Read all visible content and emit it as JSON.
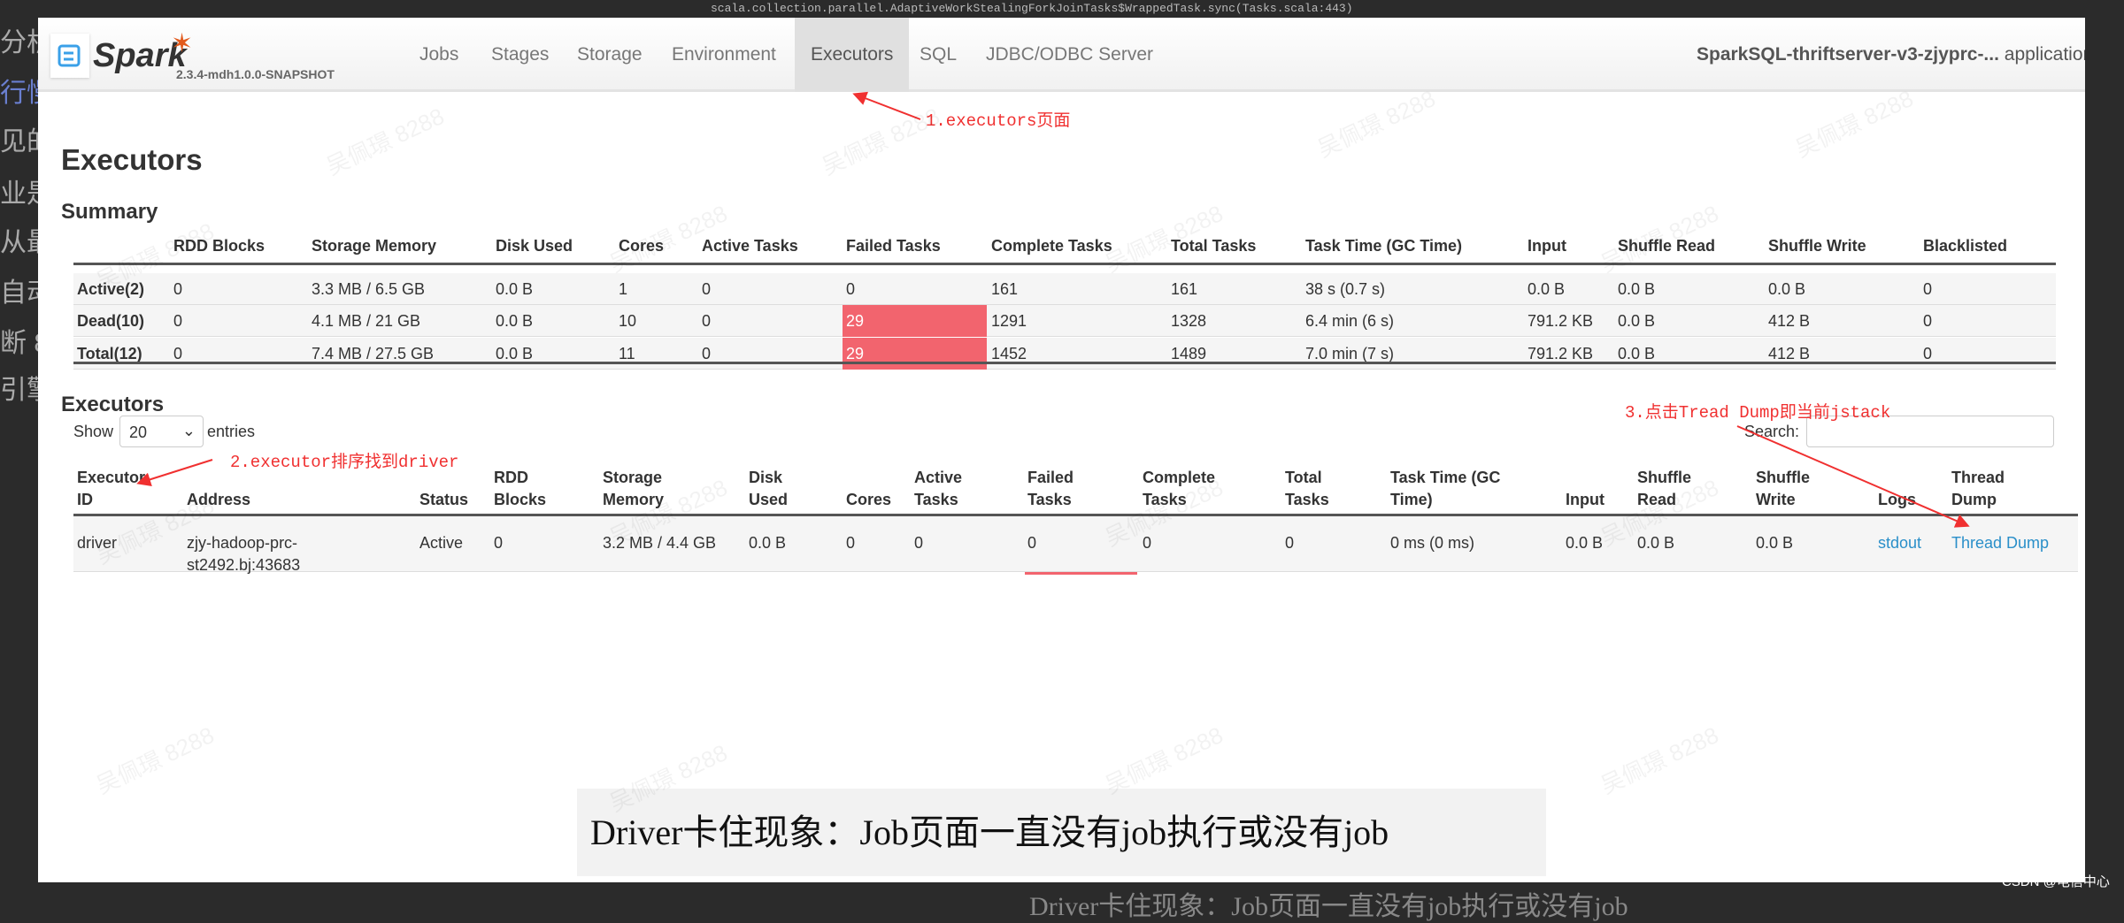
{
  "background": {
    "side_text": [
      "分析思路与技巧",
      "行慢",
      "见的",
      "业是",
      "从最",
      "自动",
      "断 8",
      "引擎"
    ],
    "top_code": "scala.collection.parallel.AdaptiveWorkStealingForkJoinTasks$WrappedTask.sync(Tasks.scala:443)",
    "bottom_text": "Driver卡住现象：Job页面一直没有job执行或没有job",
    "credit": "CSDN @电信中心"
  },
  "nav": {
    "logo_text": "Spark",
    "version": "2.3.4-mdh1.0.0-SNAPSHOT",
    "tabs": [
      "Jobs",
      "Stages",
      "Storage",
      "Environment",
      "Executors",
      "SQL",
      "JDBC/ODBC Server"
    ],
    "active_tab": "Executors",
    "app_name": "SparkSQL-thriftserver-v3-zjyprc-...",
    "app_suffix": "application"
  },
  "page_title": "Executors",
  "summary": {
    "title": "Summary",
    "headers": [
      "",
      "RDD Blocks",
      "Storage Memory",
      "Disk Used",
      "Cores",
      "Active Tasks",
      "Failed Tasks",
      "Complete Tasks",
      "Total Tasks",
      "Task Time (GC Time)",
      "Input",
      "Shuffle Read",
      "Shuffle Write",
      "Blacklisted"
    ],
    "rows": [
      [
        "Active(2)",
        "0",
        "3.3 MB / 6.5 GB",
        "0.0 B",
        "1",
        "0",
        "0",
        "161",
        "161",
        "38 s (0.7 s)",
        "0.0 B",
        "0.0 B",
        "0.0 B",
        "0"
      ],
      [
        "Dead(10)",
        "0",
        "4.1 MB / 21 GB",
        "0.0 B",
        "10",
        "0",
        "29",
        "1291",
        "1328",
        "6.4 min (6 s)",
        "791.2 KB",
        "0.0 B",
        "412 B",
        "0"
      ],
      [
        "Total(12)",
        "0",
        "7.4 MB / 27.5 GB",
        "0.0 B",
        "11",
        "0",
        "29",
        "1452",
        "1489",
        "7.0 min (7 s)",
        "791.2 KB",
        "0.0 B",
        "412 B",
        "0"
      ]
    ],
    "failed_highlight_color": "#f2646e"
  },
  "executors": {
    "title": "Executors",
    "show_label": "Show",
    "entries_value": "20",
    "entries_label": "entries",
    "search_label": "Search:",
    "search_value": "",
    "headers": [
      [
        "Executor",
        "ID"
      ],
      [
        "",
        "Address"
      ],
      [
        "",
        "Status"
      ],
      [
        "RDD",
        "Blocks"
      ],
      [
        "Storage",
        "Memory"
      ],
      [
        "Disk",
        "Used"
      ],
      [
        "",
        "Cores"
      ],
      [
        "Active",
        "Tasks"
      ],
      [
        "Failed",
        "Tasks"
      ],
      [
        "Complete",
        "Tasks"
      ],
      [
        "Total",
        "Tasks"
      ],
      [
        "Task Time (GC",
        "Time)"
      ],
      [
        "",
        "Input"
      ],
      [
        "Shuffle",
        "Read"
      ],
      [
        "Shuffle",
        "Write"
      ],
      [
        "",
        "Logs"
      ],
      [
        "Thread",
        "Dump"
      ]
    ],
    "row": [
      [
        "driver"
      ],
      [
        "zjy-hadoop-prc-",
        "st2492.bj:43683"
      ],
      [
        "Active"
      ],
      [
        "0"
      ],
      [
        "3.2 MB / 4.4 GB"
      ],
      [
        "0.0 B"
      ],
      [
        "0"
      ],
      [
        "0"
      ],
      [
        "0"
      ],
      [
        "0"
      ],
      [
        "0"
      ],
      [
        "0 ms (0 ms)"
      ],
      [
        "0.0 B"
      ],
      [
        "0.0 B"
      ],
      [
        "0.0 B"
      ],
      [
        "stdout"
      ],
      [
        "Thread Dump"
      ]
    ]
  },
  "annotations": [
    "1.executors页面",
    "2.executor排序找到driver",
    "3.点击Tread Dump即当前jstack"
  ],
  "watermark": "吴佩璟 8288"
}
